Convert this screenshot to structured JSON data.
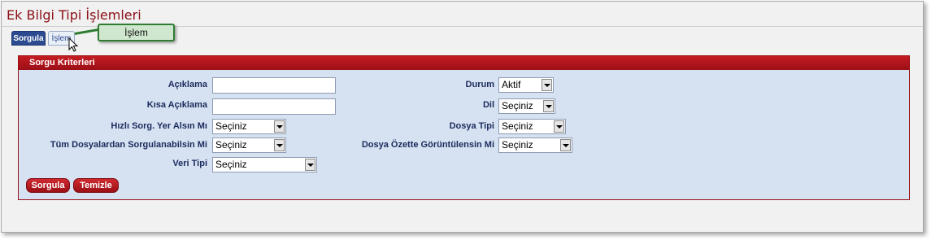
{
  "page": {
    "title": "Ek Bilgi Tipi İşlemleri"
  },
  "tabs": [
    {
      "label": "Sorgula",
      "active": true
    },
    {
      "label": "İşlem",
      "active": false
    }
  ],
  "tooltip": {
    "text": "İşlem"
  },
  "panel": {
    "header": "Sorgu Kriterleri",
    "fields": {
      "aciklama": {
        "label": "Açıklama",
        "value": ""
      },
      "kisa_aciklama": {
        "label": "Kısa Açıklama",
        "value": ""
      },
      "hizli_sorg": {
        "label": "Hızlı Sorg. Yer Alsın Mı",
        "value": "Seçiniz"
      },
      "tum_dosyalar": {
        "label": "Tüm Dosyalardan Sorgulanabilsin Mi",
        "value": "Seçiniz"
      },
      "veri_tipi": {
        "label": "Veri Tipi",
        "value": "Seçiniz"
      },
      "durum": {
        "label": "Durum",
        "value": "Aktif"
      },
      "dil": {
        "label": "Dil",
        "value": "Seçiniz"
      },
      "dosya_tipi": {
        "label": "Dosya Tipi",
        "value": "Seçiniz"
      },
      "dosya_ozet": {
        "label": "Dosya Özette Görüntülensin Mi",
        "value": "Seçiniz"
      }
    },
    "buttons": {
      "search": "Sorgula",
      "clear": "Temizle"
    }
  },
  "colors": {
    "accent": "#9b0f16",
    "panel_bg": "#d6e2f2",
    "label": "#1b2a5c",
    "tab_active": "#2b4a8f",
    "tooltip_border": "#2e7d32"
  }
}
